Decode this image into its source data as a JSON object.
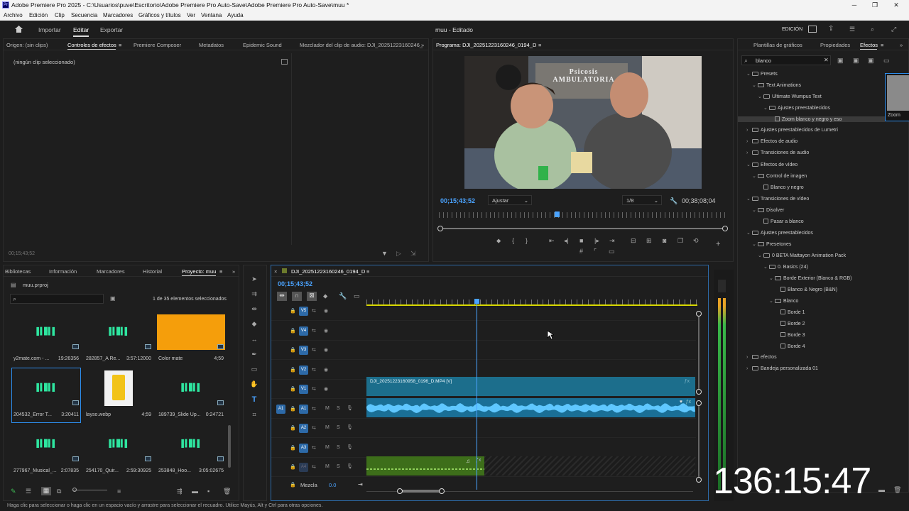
{
  "window": {
    "title": "Adobe Premiere Pro 2025 - C:\\Usuarios\\puve\\Escritorio\\Adobe Premiere Pro Auto-Save\\Adobe Premiere Pro Auto-Save\\muu *",
    "app_icon": "Pr"
  },
  "menu": [
    "Archivo",
    "Edición",
    "Clip",
    "Secuencia",
    "Marcadores",
    "Gráficos y títulos",
    "Ver",
    "Ventana",
    "Ayuda"
  ],
  "workspace": {
    "tabs": [
      "Importar",
      "Editar",
      "Exportar"
    ],
    "active": "Editar",
    "project_title": "muu - Editado",
    "mode": "EDICIÓN"
  },
  "source_panel": {
    "tabs": [
      "Origen: (sin clips)",
      "Controles de efectos",
      "Premiere Composer",
      "Metadatos",
      "Epidemic Sound",
      "Mezclador del clip de audio: DJI_20251223160246_"
    ],
    "active": "Controles de efectos",
    "empty_text": "(ningún clip seleccionado)",
    "timecode": "00;15;43;52"
  },
  "program": {
    "title": "Programa: DJI_20251223160246_0194_D",
    "timecode": "00;15;43;52",
    "fit": "Ajustar",
    "resolution": "1/8",
    "duration": "00;38;08;04",
    "sign_text": "Psicosis AMBULATORIA",
    "playhead_fraction": 0.41
  },
  "effects_panel": {
    "tabs": [
      "Plantillas de gráficos",
      "Propiedades",
      "Efectos"
    ],
    "active": "Efectos",
    "search": "blanco",
    "thumb_label": "Zoom",
    "tree": [
      {
        "level": 0,
        "type": "folder",
        "open": true,
        "label": "Presets"
      },
      {
        "level": 1,
        "type": "folder",
        "open": true,
        "label": "Text Animations"
      },
      {
        "level": 2,
        "type": "folder",
        "open": true,
        "label": "Ultimate Wumpus Text"
      },
      {
        "level": 3,
        "type": "folder",
        "open": true,
        "label": "Ajustes preestablecidos"
      },
      {
        "level": 4,
        "type": "preset",
        "label": "Zoom blanco y negro y eso",
        "selected": true
      },
      {
        "level": 0,
        "type": "folder",
        "open": false,
        "label": "Ajustes preestablecidos de Lumetri"
      },
      {
        "level": 0,
        "type": "folder",
        "open": false,
        "label": "Efectos de audio"
      },
      {
        "level": 0,
        "type": "folder",
        "open": false,
        "label": "Transiciones de audio"
      },
      {
        "level": 0,
        "type": "folder",
        "open": true,
        "label": "Efectos de vídeo"
      },
      {
        "level": 1,
        "type": "folder",
        "open": true,
        "label": "Control de imagen"
      },
      {
        "level": 2,
        "type": "preset",
        "label": "Blanco y negro"
      },
      {
        "level": 0,
        "type": "folder",
        "open": true,
        "label": "Transiciones de vídeo"
      },
      {
        "level": 1,
        "type": "folder",
        "open": true,
        "label": "Disolver"
      },
      {
        "level": 2,
        "type": "preset",
        "label": "Pasar a blanco"
      },
      {
        "level": 0,
        "type": "folder",
        "open": true,
        "label": "Ajustes preestablecidos"
      },
      {
        "level": 1,
        "type": "folder",
        "open": true,
        "label": "Presetones"
      },
      {
        "level": 2,
        "type": "folder",
        "open": true,
        "label": "0 BETA Mattayon Animation Pack"
      },
      {
        "level": 3,
        "type": "folder",
        "open": true,
        "label": "0. Basics (24)"
      },
      {
        "level": 4,
        "type": "folder",
        "open": true,
        "label": "Borde Exterior (Blanco & RGB)"
      },
      {
        "level": 5,
        "type": "preset",
        "label": "Blanco & Negro (B&N)"
      },
      {
        "level": 4,
        "type": "folder",
        "open": true,
        "label": "Blanco"
      },
      {
        "level": 5,
        "type": "preset",
        "label": "Borde 1"
      },
      {
        "level": 5,
        "type": "preset",
        "label": "Borde 2"
      },
      {
        "level": 5,
        "type": "preset",
        "label": "Borde 3"
      },
      {
        "level": 5,
        "type": "preset",
        "label": "Borde 4"
      },
      {
        "level": 0,
        "type": "folder",
        "open": false,
        "label": "efectos"
      },
      {
        "level": 0,
        "type": "folder",
        "open": false,
        "label": "Bandeja personalizada 01"
      }
    ]
  },
  "project_panel": {
    "tabs": [
      "Bibliotecas",
      "Información",
      "Marcadores",
      "Historial",
      "Proyecto: muu"
    ],
    "active": "Proyecto: muu",
    "file": "muu.prproj",
    "count": "1 de 35 elementos seleccionados",
    "items": [
      {
        "name": "y2mate.com - ...",
        "dur": "19:26356",
        "kind": "audio"
      },
      {
        "name": "282857_A Re...",
        "dur": "3:57:12000",
        "kind": "audio"
      },
      {
        "name": "Color mate",
        "dur": "4;59",
        "kind": "color"
      },
      {
        "name": "204532_Error T...",
        "dur": "3:20411",
        "kind": "audio",
        "selected": true
      },
      {
        "name": "layso.webp",
        "dur": "4;59",
        "kind": "image"
      },
      {
        "name": "189739_Slide Up...",
        "dur": "0:24721",
        "kind": "audio"
      },
      {
        "name": "277967_Musical_...",
        "dur": "2:07835",
        "kind": "audio"
      },
      {
        "name": "254170_Quir...",
        "dur": "2:59:30925",
        "kind": "audio"
      },
      {
        "name": "253848_Hoo...",
        "dur": "3:05:02675",
        "kind": "audio"
      }
    ]
  },
  "timeline": {
    "sequence": "DJI_20251223160246_0194_D",
    "timecode": "00;15;43;52",
    "video_tracks": [
      "V5",
      "V4",
      "V3",
      "V2",
      "V1"
    ],
    "audio_tracks": [
      "A1",
      "A2",
      "A3",
      "A4"
    ],
    "source_patch": "A1",
    "clip_v1": "DJI_20251223160958_0196_D.MP4 [V]",
    "mix_label": "Mezcla",
    "mix_value": "0.0"
  },
  "overlay_counter": "136:15:47",
  "status": "Haga clic para seleccionar o haga clic en un espacio vacío y arrastre para seleccionar el recuadro. Utilice Mayús, Alt y Ctrl para otras opciones.",
  "colors": {
    "accent": "#2d8ceb",
    "clip_video": "#1c6e8c",
    "clip_audio": "#1f8fb8",
    "clip_green": "#3d6e1a",
    "color_matte": "#f59e0b"
  }
}
